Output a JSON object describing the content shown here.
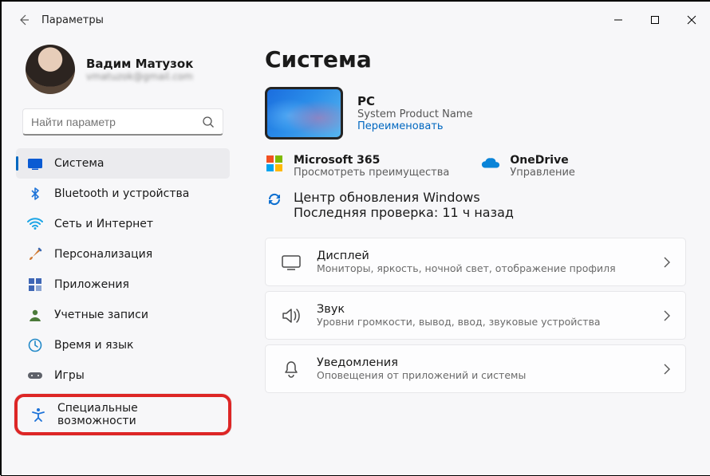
{
  "window": {
    "title": "Параметры"
  },
  "user": {
    "name": "Вадим Матузок",
    "email": "vmatuzok@gmail.com"
  },
  "search": {
    "placeholder": "Найти параметр"
  },
  "sidebar": {
    "items": [
      {
        "label": "Система"
      },
      {
        "label": "Bluetooth и устройства"
      },
      {
        "label": "Сеть и Интернет"
      },
      {
        "label": "Персонализация"
      },
      {
        "label": "Приложения"
      },
      {
        "label": "Учетные записи"
      },
      {
        "label": "Время и язык"
      },
      {
        "label": "Игры"
      },
      {
        "label": "Специальные возможности"
      }
    ]
  },
  "main": {
    "heading": "Система",
    "pc": {
      "name": "PC",
      "product": "System Product Name",
      "rename": "Переименовать"
    },
    "tiles": {
      "m365": {
        "title": "Microsoft 365",
        "sub": "Просмотреть преимущества"
      },
      "onedrive": {
        "title": "OneDrive",
        "sub": "Управление"
      },
      "wu": {
        "title": "Центр обновления Windows",
        "sub": "Последняя проверка: 11 ч назад"
      }
    },
    "rows": [
      {
        "title": "Дисплей",
        "sub": "Мониторы, яркость, ночной свет, отображение профиля"
      },
      {
        "title": "Звук",
        "sub": "Уровни громкости, вывод, ввод, звуковые устройства"
      },
      {
        "title": "Уведомления",
        "sub": "Оповещения от приложений и системы"
      }
    ]
  }
}
